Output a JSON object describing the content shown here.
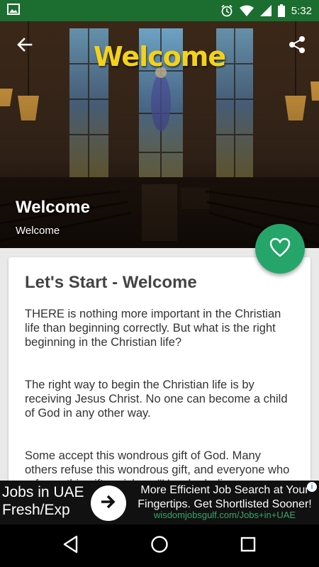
{
  "status_bar": {
    "time": "5:32",
    "icons": [
      "image-icon",
      "alarm-icon",
      "wifi-icon",
      "signal-icon",
      "battery-icon"
    ]
  },
  "hero": {
    "logo_text": "Welcome",
    "title": "Welcome",
    "subtitle": "Welcome",
    "back_icon": "arrow-back-icon",
    "share_icon": "share-icon"
  },
  "fab": {
    "icon": "heart-outline-icon",
    "color": "#25a56a"
  },
  "card": {
    "heading": "Let's Start - Welcome",
    "paragraphs": [
      "THERE is nothing more important in the Christian life than beginning correctly. But what is the right beginning in the Christian life?",
      "The right way to begin the Christian life is by receiving Jesus Christ. No one can become a child of God in any other way.",
      "Some accept this wondrous gift of God. Many others refuse this wondrous gift, and everyone who refuses this gift perishes. \"He who believes"
    ]
  },
  "ad": {
    "left_line1": "Jobs in UAE",
    "left_line2": "Fresh/Exp",
    "headline": "More Efficient Job Search at Your Fingertips. Get Shortlisted Sooner!",
    "url": "wisdomjobsgulf.com/Jobs+in+UAE",
    "info_icon": "ad-info-icon"
  },
  "colors": {
    "status_bar": "#1b6e2f",
    "accent": "#25a56a",
    "logo": "#f3d21a"
  }
}
